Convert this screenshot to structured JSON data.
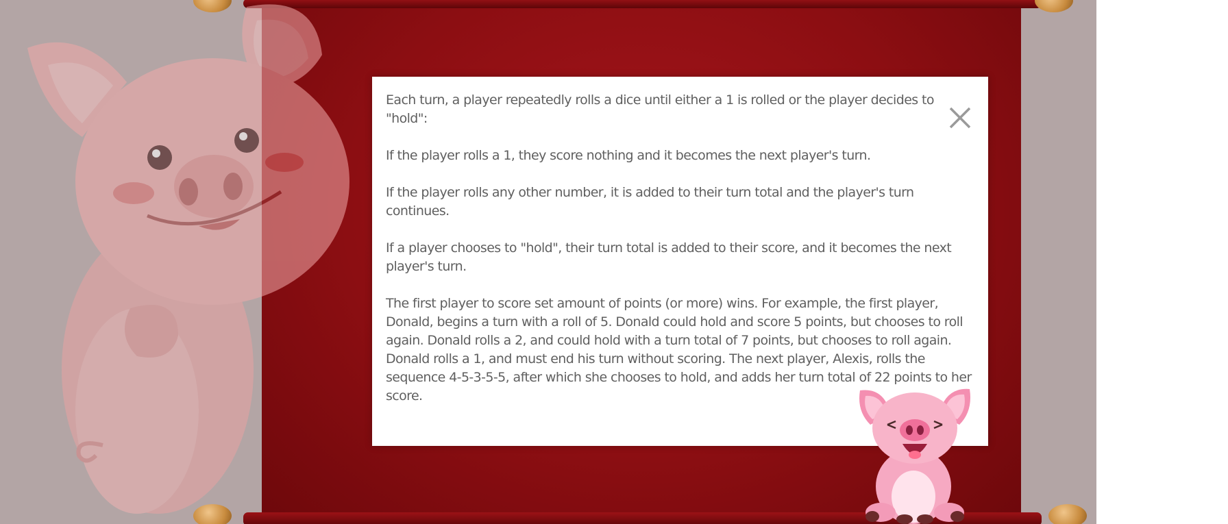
{
  "rules_modal": {
    "paragraphs": [
      "Each turn, a player repeatedly rolls a dice until either a 1 is rolled or the player decides to \"hold\":",
      "If the player rolls a 1, they score nothing and it becomes the next player's turn.",
      "If the player rolls any other number, it is added to their turn total and the player's turn continues.",
      "If a player chooses to \"hold\", their turn total is added to their score, and it becomes the next player's turn.",
      "The first player to score set amount of points (or more) wins. For example, the first player, Donald, begins a turn with a roll of 5. Donald could hold and score 5 points, but chooses to roll again. Donald rolls a 2, and could hold with a turn total of 7 points, but chooses to roll again. Donald rolls a 1, and must end his turn without scoring. The next player, Alexis, rolls the sequence 4-5-3-5-5, after which she chooses to hold, and adds her turn total of 22 points to her score."
    ],
    "close_icon": "close-icon"
  },
  "decor": {
    "background_pig_icon": "pig-illustration",
    "small_pig_icon": "laughing-pig-illustration",
    "scroll_color": "#8c0e12",
    "background_color": "#b3a5a5"
  }
}
